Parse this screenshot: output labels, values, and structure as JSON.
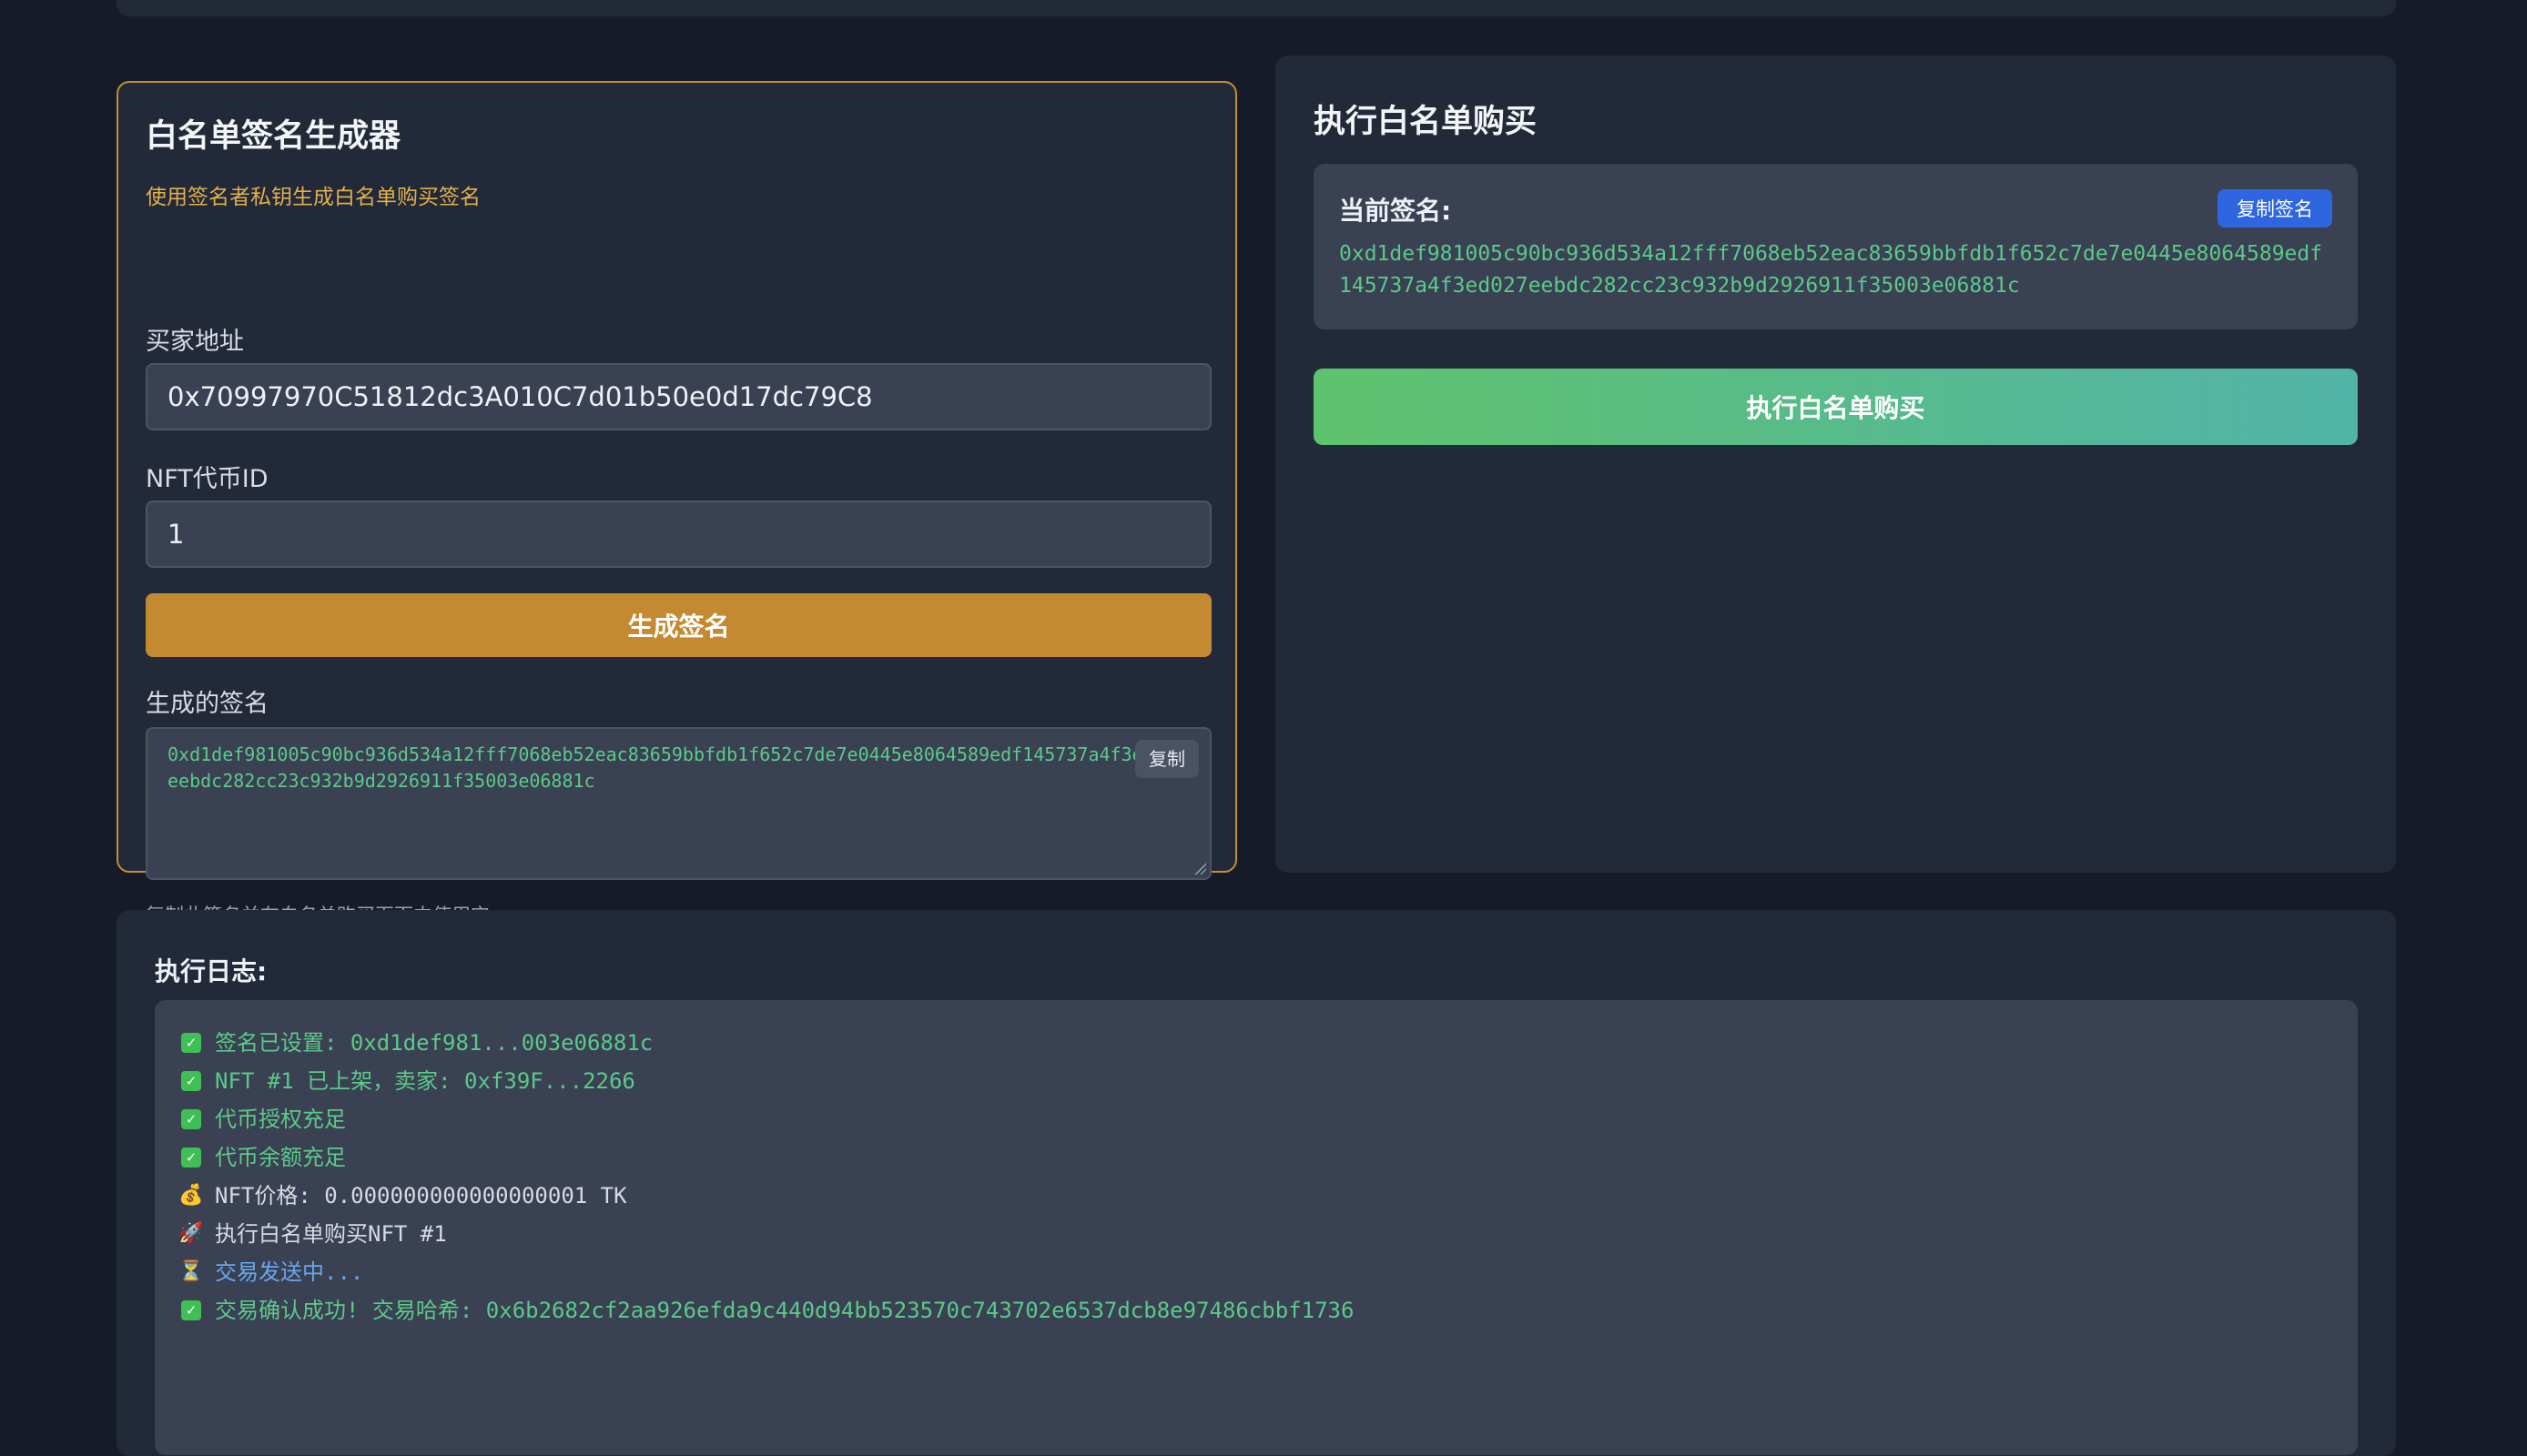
{
  "generator": {
    "title": "白名单签名生成器",
    "subtitle": "使用签名者私钥生成白名单购买签名",
    "buyer_label": "买家地址",
    "buyer_value": "0x70997970C51812dc3A010C7d01b50e0d17dc79C8",
    "token_label": "NFT代币ID",
    "token_value": "1",
    "generate_button": "生成签名",
    "generated_label": "生成的签名",
    "generated_signature": "0xd1def981005c90bc936d534a12fff7068eb52eac83659bbfdb1f652c7de7e0445e8064589edf145737a4f3ed027eebdc282cc23c932b9d2926911f35003e06881c",
    "copy_button": "复制",
    "hint": "复制此签名并在白名单购买页面中使用它"
  },
  "purchase": {
    "title": "执行白名单购买",
    "current_label": "当前签名:",
    "copy_signature_button": "复制签名",
    "current_signature": "0xd1def981005c90bc936d534a12fff7068eb52eac83659bbfdb1f652c7de7e0445e8064589edf145737a4f3ed027eebdc282cc23c932b9d2926911f35003e06881c",
    "execute_button": "执行白名单购买"
  },
  "log": {
    "title": "执行日志:",
    "lines": [
      {
        "icon": "check-icon",
        "glyph": "✓",
        "status": "ok",
        "text": "签名已设置: 0xd1def981...003e06881c"
      },
      {
        "icon": "check-icon",
        "glyph": "✓",
        "status": "ok",
        "text": "NFT #1 已上架，卖家: 0xf39F...2266"
      },
      {
        "icon": "check-icon",
        "glyph": "✓",
        "status": "ok",
        "text": "代币授权充足"
      },
      {
        "icon": "check-icon",
        "glyph": "✓",
        "status": "ok",
        "text": "代币余额充足"
      },
      {
        "icon": "money-bag-icon",
        "glyph": "💰",
        "status": "info",
        "text": "NFT价格: 0.000000000000000001 TK"
      },
      {
        "icon": "rocket-icon",
        "glyph": "🚀",
        "status": "info",
        "text": "执行白名单购买NFT #1"
      },
      {
        "icon": "hourglass-icon",
        "glyph": "⏳",
        "status": "pending",
        "text": "交易发送中..."
      },
      {
        "icon": "check-icon",
        "glyph": "✓",
        "status": "ok",
        "text": "交易确认成功! 交易哈希: 0x6b2682cf2aa926efda9c440d94bb523570c743702e6537dcb8e97486cbbf1736"
      }
    ]
  }
}
